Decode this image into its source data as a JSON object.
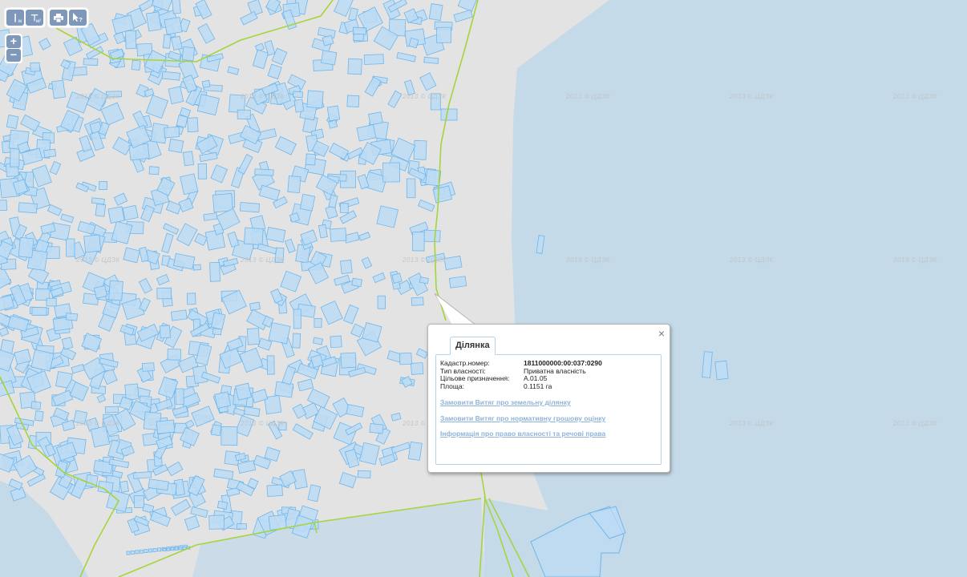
{
  "toolbar": {
    "measure_line_unit": "м",
    "measure_area_unit": "м²"
  },
  "zoom": {
    "in_label": "+",
    "out_label": "−"
  },
  "watermark_text": "2013 © ЦДЗК",
  "colors": {
    "land": "#e3e3e3",
    "water": "#c5dae9",
    "parcel_fill": "#bcdcf5",
    "parcel_stroke": "#6fb6ea",
    "boundary": "#a6d43c",
    "toolbar_button": "#7f98b9",
    "link": "#8fb3d9"
  },
  "popup": {
    "close_label": "×",
    "tab_label": "Ділянка",
    "fields": [
      {
        "label": "Кадастр.номер:",
        "value": "1811000000:00:037:0290"
      },
      {
        "label": "Тип власності:",
        "value": "Приватна власність"
      },
      {
        "label": "Цільове призначення:",
        "value": "A.01.05"
      },
      {
        "label": "Площа:",
        "value": "0.1151 га"
      }
    ],
    "links": [
      "Замовити Витяг про земельну ділянку",
      "Замовити Витяг про нормативну грошову оцінку",
      "Інформація про право власності та речові права"
    ]
  }
}
